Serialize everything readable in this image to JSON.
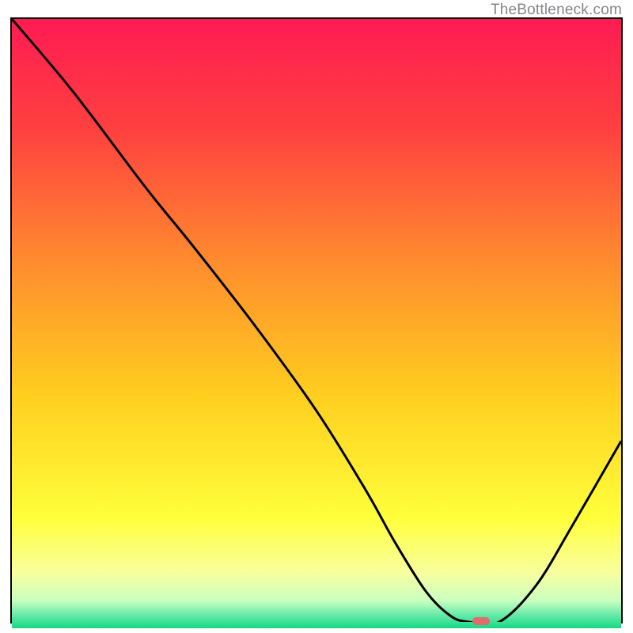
{
  "watermark": "TheBottleneck.com",
  "colors": {
    "border": "#000000",
    "curve": "#000000",
    "marker": "#e16d6b",
    "gradient_stops": [
      {
        "y": 0.0,
        "color": "#ff1b52"
      },
      {
        "y": 0.18,
        "color": "#ff4040"
      },
      {
        "y": 0.4,
        "color": "#ff8c2e"
      },
      {
        "y": 0.62,
        "color": "#ffcf1f"
      },
      {
        "y": 0.82,
        "color": "#ffff3b"
      },
      {
        "y": 0.91,
        "color": "#f7ffa0"
      },
      {
        "y": 0.955,
        "color": "#c9ffc0"
      },
      {
        "y": 0.98,
        "color": "#5fe8a6"
      },
      {
        "y": 1.0,
        "color": "#18d885"
      }
    ]
  },
  "chart_data": {
    "type": "line",
    "title": "",
    "xlabel": "",
    "ylabel": "",
    "xlim": [
      0,
      100
    ],
    "ylim": [
      0,
      100
    ],
    "series": [
      {
        "name": "bottleneck-curve",
        "x": [
          0,
          10,
          22,
          30,
          40,
          50,
          58,
          63,
          68,
          72,
          75,
          80,
          86,
          92,
          100
        ],
        "values": [
          100,
          88,
          72,
          62,
          49,
          35,
          22,
          13,
          5,
          1,
          0,
          0,
          6,
          16,
          30
        ]
      }
    ],
    "annotations": [
      {
        "name": "optimal-marker",
        "x": 77,
        "y": 0
      }
    ]
  }
}
